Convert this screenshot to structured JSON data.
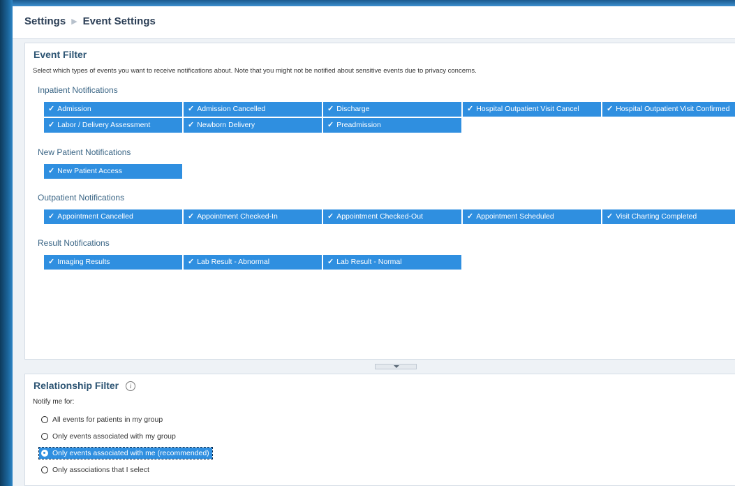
{
  "breadcrumb": {
    "root": "Settings",
    "separator": "▶",
    "current": "Event Settings"
  },
  "event_filter": {
    "title": "Event Filter",
    "description": "Select which types of events you want to receive notifications about. Note that you might not be notified about sensitive events due to privacy concerns.",
    "check_glyph": "✓",
    "groups": {
      "inpatient": {
        "title": "Inpatient Notifications",
        "items": [
          "Admission",
          "Admission Cancelled",
          "Discharge",
          "Hospital Outpatient Visit Cancel",
          "Hospital Outpatient Visit Confirmed",
          "Labor / Delivery Assessment",
          "Newborn Delivery",
          "Preadmission"
        ]
      },
      "new_patient": {
        "title": "New Patient Notifications",
        "items": [
          "New Patient Access"
        ]
      },
      "outpatient": {
        "title": "Outpatient Notifications",
        "items": [
          "Appointment Cancelled",
          "Appointment Checked-In",
          "Appointment Checked-Out",
          "Appointment Scheduled",
          "Visit Charting Completed"
        ]
      },
      "result": {
        "title": "Result Notifications",
        "items": [
          "Imaging Results",
          "Lab Result - Abnormal",
          "Lab Result - Normal"
        ]
      }
    }
  },
  "relationship_filter": {
    "title": "Relationship Filter",
    "info_glyph": "i",
    "notify_label": "Notify me for:",
    "options": [
      "All events for patients in my group",
      "Only events associated with my group",
      "Only events associated with me (recommended)",
      "Only associations that I select"
    ],
    "selected_option": "Only events associated with me (recommended)"
  },
  "colors": {
    "chip_bg": "#2f8fe0",
    "title_color": "#2b5372",
    "group_color": "#3a6585"
  }
}
